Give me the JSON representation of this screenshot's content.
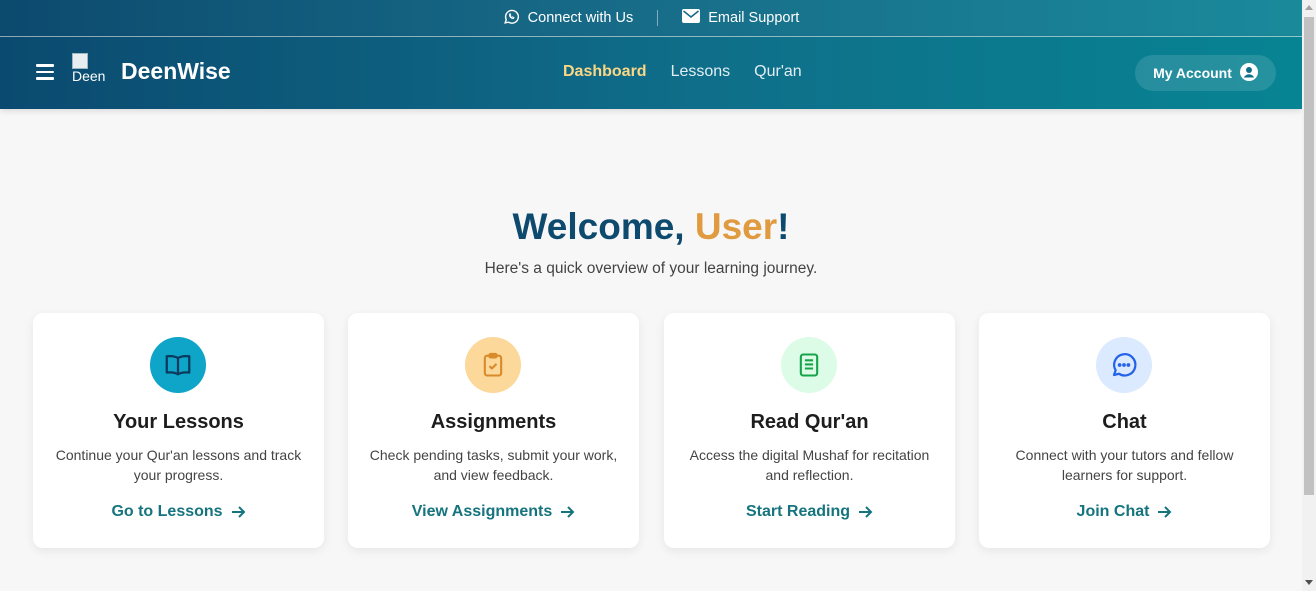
{
  "topbar": {
    "connect_label": "Connect with Us",
    "email_label": "Email Support"
  },
  "navbar": {
    "logo_alt": "Deen",
    "brand": "DeenWise",
    "links": [
      {
        "label": "Dashboard",
        "active": true
      },
      {
        "label": "Lessons",
        "active": false
      },
      {
        "label": "Qur'an",
        "active": false
      }
    ],
    "account_label": "My Account"
  },
  "hero": {
    "greeting": "Welcome, ",
    "username": "User",
    "exclaim": "!",
    "subtitle": "Here's a quick overview of your learning journey."
  },
  "cards": [
    {
      "icon": "book-open-icon",
      "color": "#0ea5c9",
      "title": "Your Lessons",
      "description": "Continue your Qur'an lessons and track your progress.",
      "cta": "Go to Lessons"
    },
    {
      "icon": "clipboard-check-icon",
      "color": "#fcd89a",
      "title": "Assignments",
      "description": "Check pending tasks, submit your work, and view feedback.",
      "cta": "View Assignments"
    },
    {
      "icon": "book-icon",
      "color": "#dcfce7",
      "title": "Read Qur'an",
      "description": "Access the digital Mushaf for recitation and reflection.",
      "cta": "Start Reading"
    },
    {
      "icon": "chat-bubble-icon",
      "color": "#dbeafe",
      "title": "Chat",
      "description": "Connect with your tutors and fellow learners for support.",
      "cta": "Join Chat"
    }
  ]
}
